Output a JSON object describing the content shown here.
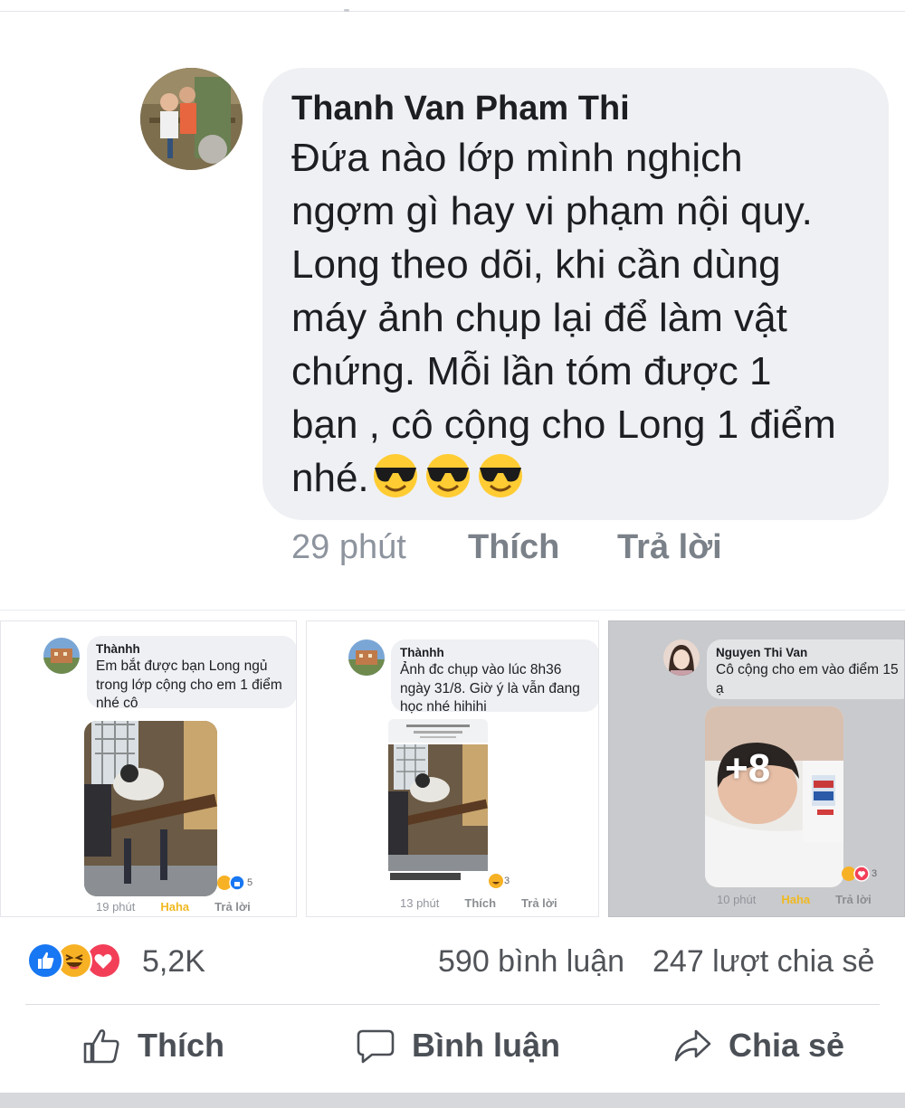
{
  "main_comment": {
    "author": "Thanh Van Pham Thi",
    "lines": [
      "Đứa nào lớp mình nghịch",
      "ngợm gì hay vi phạm nội quy.",
      "Long theo dõi, khi cần dùng",
      "máy ảnh chụp lại để làm vật",
      "chứng. Mỗi lần tóm được 1",
      "bạn , cô cộng cho Long 1 điểm",
      "nhé."
    ],
    "emoji": "smiling-face-with-sunglasses-icon",
    "time": "29 phút",
    "like_label": "Thích",
    "reply_label": "Trả lời"
  },
  "cards": [
    {
      "author": "Thànhh",
      "lines": [
        "Em bắt được bạn Long ngủ",
        "trong lớp cộng cho em 1 điểm",
        "nhé cô"
      ],
      "time": "19 phút",
      "reaction_label": "Haha",
      "reply_label": "Trả lời",
      "reaction_count": "5"
    },
    {
      "author": "Thànhh",
      "lines": [
        "Ảnh đc chụp vào lúc 8h36",
        "ngày 31/8. Giờ ý là vẫn đang",
        "học nhé hihihi"
      ],
      "time": "13 phút",
      "like_label": "Thích",
      "reply_label": "Trả lời",
      "reaction_count": "3"
    },
    {
      "author": "Nguyen Thi Van",
      "lines": [
        "Cô cộng cho em vào điểm 15",
        "ạ"
      ],
      "overlay": "+8",
      "time": "10 phút",
      "reaction_label": "Haha",
      "reply_label": "Trả lời",
      "reaction_count": "3"
    }
  ],
  "stats": {
    "reactions": "5,2K",
    "comments": "590 bình luận",
    "shares": "247 lượt chia sẻ"
  },
  "actions": {
    "like": "Thích",
    "comment": "Bình luận",
    "share": "Chia sẻ"
  },
  "colors": {
    "bubble": "#eff0f3",
    "like_blue": "#1877f2",
    "haha_yellow": "#f7b125",
    "love_red": "#f33e58",
    "muted_text": "#8d949e"
  }
}
